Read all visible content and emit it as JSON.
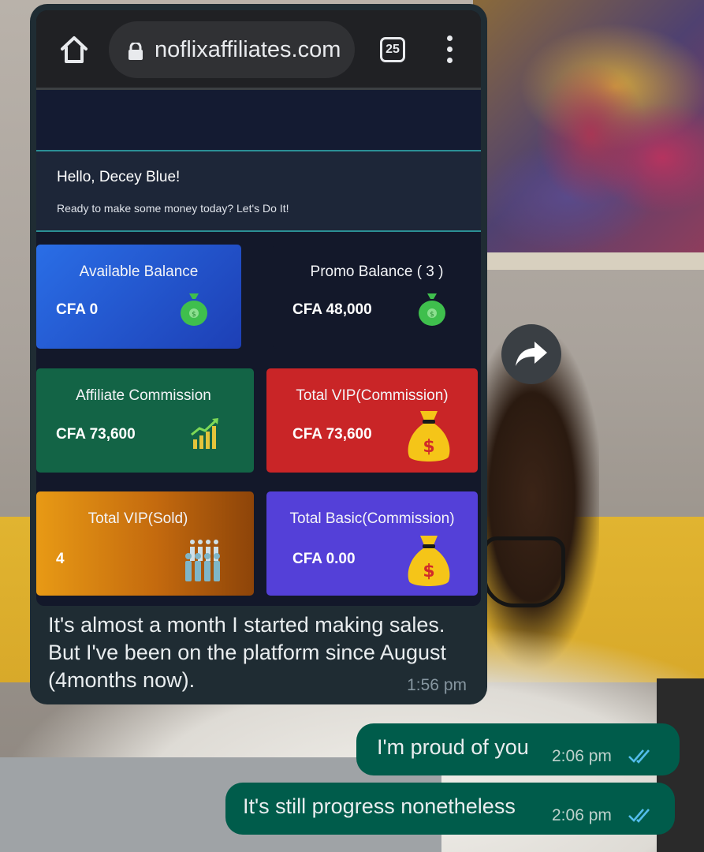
{
  "browser": {
    "url": "noflixaffiliates.com",
    "tab_count": "25"
  },
  "greeting": {
    "title": "Hello, Decey Blue!",
    "subtitle": "Ready to make some money today? Let's Do It!"
  },
  "cards": {
    "available": {
      "title": "Available Balance",
      "value": "CFA 0",
      "icon": "money-bag-icon"
    },
    "promo": {
      "title": "Promo Balance ( 3 )",
      "value": "CFA 48,000",
      "icon": "money-bag-icon"
    },
    "affiliate": {
      "title": "Affiliate Commission",
      "value": "CFA 73,600",
      "icon": "growth-chart-icon"
    },
    "vip_commission": {
      "title": "Total VIP(Commission)",
      "value": "CFA 73,600",
      "icon": "dollar-sack-icon"
    },
    "vip_sold": {
      "title": "Total VIP(Sold)",
      "value": "4",
      "icon": "people-group-icon"
    },
    "basic_commission": {
      "title": "Total Basic(Commission)",
      "value": "CFA 0.00",
      "icon": "dollar-sack-icon"
    }
  },
  "incoming_message": {
    "text": "It's almost a month I started making sales. But I've been on the platform since August (4months now).",
    "time": "1:56 pm"
  },
  "outgoing_messages": [
    {
      "text": "I'm proud of you",
      "time": "2:06 pm",
      "status": "read"
    },
    {
      "text": "It's still progress nonetheless",
      "time": "2:06 pm",
      "status": "read"
    }
  ],
  "colors": {
    "incoming_bubble": "#1f2c33",
    "outgoing_bubble": "#005c4b",
    "read_ticks": "#53bdeb"
  }
}
